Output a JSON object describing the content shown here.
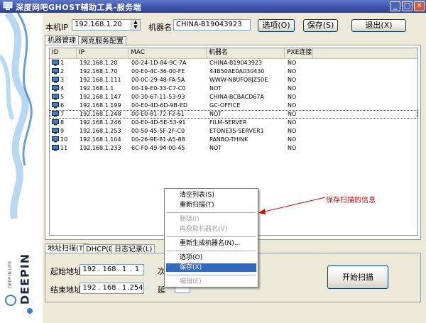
{
  "window": {
    "title": "深度网吧GHOST辅助工具-服务端",
    "min_glyph": "_",
    "max_glyph": "□",
    "close_glyph": "✕"
  },
  "toolbar": {
    "local_ip_label": "本机IP",
    "local_ip_value": "192.168.1.20",
    "machine_name_label": "机器名",
    "machine_name_value": "CHINA-B19043923",
    "options_button": "选项(O)",
    "save_button": "保存(S)",
    "exit_button": "退出(X)"
  },
  "top_tabs": [
    "机器管理",
    "网克服务配置"
  ],
  "table": {
    "headers": [
      "ID",
      "IP",
      "MAC",
      "机器名",
      "PXE连接"
    ],
    "rows": [
      {
        "id": "1",
        "ip": "192.168.1.20",
        "mac": "00-24-1D-84-9C-7A",
        "name": "CHINA-B19043923",
        "pxe": "NO"
      },
      {
        "id": "2",
        "ip": "192.168.1.70",
        "mac": "00-E0-4C-36-00-FE",
        "name": "44B50AE0A030430",
        "pxe": "NO"
      },
      {
        "id": "3",
        "ip": "192.168.1.111",
        "mac": "00-0C-29-48-FA-5A",
        "name": "WWW-N8UFQ8JZ50E",
        "pxe": "NO"
      },
      {
        "id": "4",
        "ip": "192.168.1.1",
        "mac": "00-19-E0-33-C7-C0",
        "name": "NOT",
        "pxe": "NO"
      },
      {
        "id": "5",
        "ip": "192.168.1.147",
        "mac": "00-30-67-11-53-93",
        "name": "CHINA-BCBACD67A",
        "pxe": "NO"
      },
      {
        "id": "6",
        "ip": "192.168.1.199",
        "mac": "00-E0-4D-6D-9B-ED",
        "name": "GC-OFFICE",
        "pxe": "NO"
      },
      {
        "id": "7",
        "ip": "192.168.1.248",
        "mac": "00-E0-81-72-F2-61",
        "name": "NOT",
        "pxe": "NO"
      },
      {
        "id": "8",
        "ip": "192.168.1.246",
        "mac": "00-E0-4D-5E-53-91",
        "name": "FILM-SERVER",
        "pxe": "NO"
      },
      {
        "id": "9",
        "ip": "192.168.1.253",
        "mac": "00-50-45-5F-2F-C0",
        "name": "ETONE3S-SERVER1",
        "pxe": "NO"
      },
      {
        "id": "10",
        "ip": "192.168.1.104",
        "mac": "00-26-9E-81-A5-88",
        "name": "PANBO-THINK",
        "pxe": "NO"
      },
      {
        "id": "11",
        "ip": "192.168.1.233",
        "mac": "6C-F0-49-94-00-45",
        "name": "NOT",
        "pxe": "NO"
      }
    ]
  },
  "context_menu": {
    "items": [
      "清空列表(S)",
      "重新扫描(T)",
      "删除(I)",
      "再获取机器名(V)",
      "重新生成机器名(N)...",
      "选项(O)",
      "保存(X)",
      "编辑(E)"
    ]
  },
  "annotation": "保存扫描的信息",
  "bottom_tabs": [
    "地址扫描(T)",
    "DHCP(D)",
    "日志记录(L)"
  ],
  "scan": {
    "start_label": "起始地址",
    "end_label": "结束地址",
    "start_ip": [
      "192",
      "168",
      "1",
      "1"
    ],
    "end_ip": [
      "192",
      "168",
      "1",
      "254"
    ],
    "count_label": "次",
    "delay_label": "延",
    "start_button": "开始扫描"
  },
  "brand": {
    "name": "DEEPIN",
    "tagline": "DEEP IN LIFE"
  },
  "colors": {
    "titlebar": "#3f56b0",
    "highlight": "#316ac5",
    "annotation": "#e00000"
  }
}
